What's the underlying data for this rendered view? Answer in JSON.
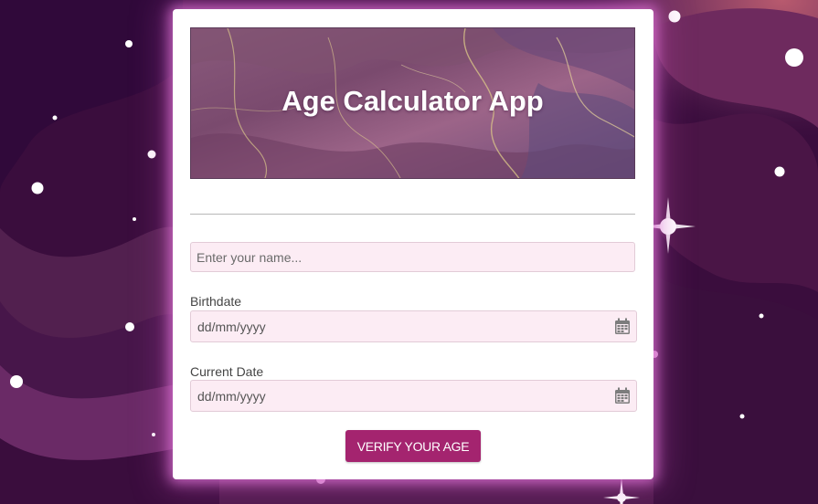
{
  "app": {
    "title": "Age Calculator App"
  },
  "form": {
    "name_placeholder": "Enter your name...",
    "name_value": "",
    "birthdate_label": "Birthdate",
    "birthdate_value": "dd/mm/yyyy",
    "current_date_label": "Current Date",
    "current_date_value": "dd/mm/yyyy",
    "verify_label": "VERIFY YOUR AGE"
  },
  "icons": {
    "birthdate_picker": "calendar-icon",
    "current_date_picker": "calendar-icon"
  },
  "colors": {
    "background": "#3a0d3d",
    "button": "#a4246f",
    "input_background": "#fcecf4",
    "card": "#ffffff"
  }
}
